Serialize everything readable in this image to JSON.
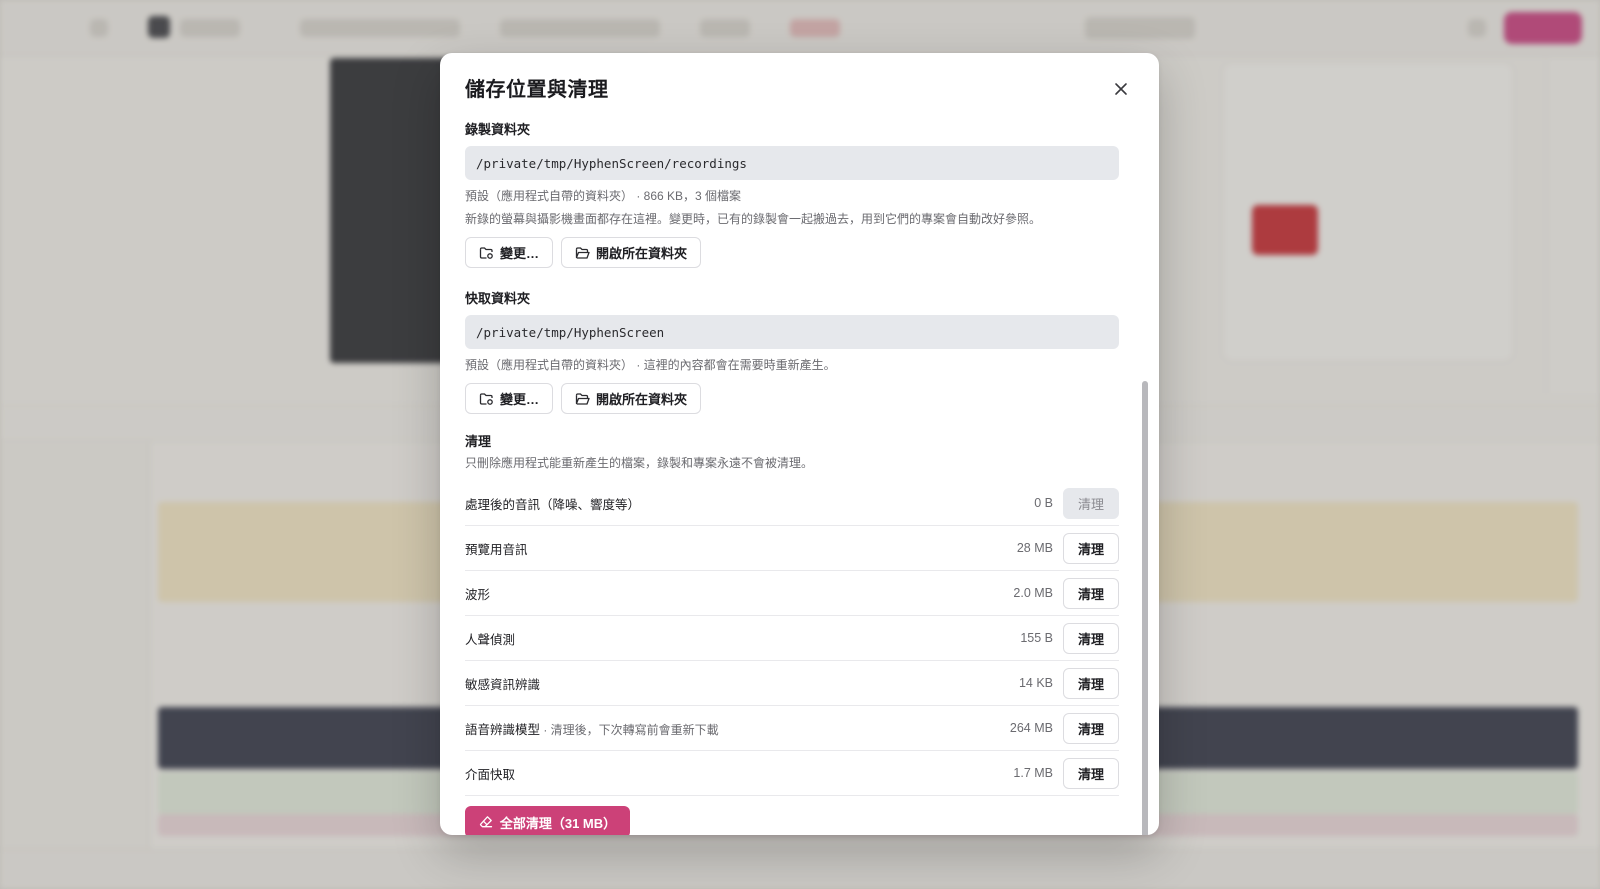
{
  "modal": {
    "title": "儲存位置與清理",
    "recordings": {
      "label": "錄製資料夾",
      "path": "/private/tmp/HyphenScreen/recordings",
      "meta": "預設（應用程式自帶的資料夾） · 866 KB，3 個檔案",
      "description": "新錄的螢幕與攝影機畫面都存在這裡。變更時，已有的錄製會一起搬過去，用到它們的專案會自動改好參照。",
      "change_label": "變更…",
      "open_label": "開啟所在資料夾"
    },
    "cache": {
      "label": "快取資料夾",
      "path": "/private/tmp/HyphenScreen",
      "meta": "預設（應用程式自帶的資料夾） · 這裡的內容都會在需要時重新產生。",
      "change_label": "變更…",
      "open_label": "開啟所在資料夾"
    },
    "cleanup": {
      "label": "清理",
      "description": "只刪除應用程式能重新產生的檔案，錄製和專案永遠不會被清理。",
      "button_label": "清理",
      "items": [
        {
          "name": "處理後的音訊（降噪、響度等）",
          "note": "",
          "size": "0 B",
          "disabled": true
        },
        {
          "name": "預覽用音訊",
          "note": "",
          "size": "28 MB",
          "disabled": false
        },
        {
          "name": "波形",
          "note": "",
          "size": "2.0 MB",
          "disabled": false
        },
        {
          "name": "人聲偵測",
          "note": "",
          "size": "155 B",
          "disabled": false
        },
        {
          "name": "敏感資訊辨識",
          "note": "",
          "size": "14 KB",
          "disabled": false
        },
        {
          "name": "語音辨識模型",
          "note": " · 清理後，下次轉寫前會重新下載",
          "size": "264 MB",
          "disabled": false
        },
        {
          "name": "介面快取",
          "note": "",
          "size": "1.7 MB",
          "disabled": false
        }
      ],
      "all_label": "全部清理（31 MB）"
    }
  },
  "colors": {
    "accent": "#cc4178",
    "path_bg": "#e6e8ec",
    "muted_text": "#6b6b70"
  },
  "icons": {
    "close": "close-icon",
    "change": "folder-gear-icon",
    "open": "folder-open-icon",
    "clean_all": "eraser-icon"
  }
}
